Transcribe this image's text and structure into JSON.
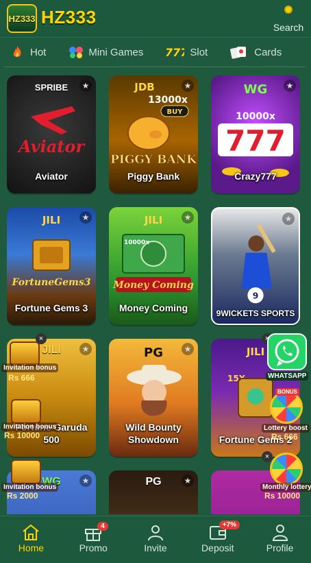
{
  "header": {
    "logo_badge": "HZ333",
    "brand": "HZ333",
    "search_label": "Search"
  },
  "categories": [
    {
      "label": "Hot",
      "icon": "flame-icon"
    },
    {
      "label": "Mini Games",
      "icon": "mini-games-icon"
    },
    {
      "label": "Slot",
      "icon": "slot-777-icon"
    },
    {
      "label": "Cards",
      "icon": "cards-icon"
    }
  ],
  "games": [
    {
      "title": "Aviator",
      "provider": "SPRIBE",
      "art_text": "Aviator"
    },
    {
      "title": "Piggy Bank",
      "provider": "JDB",
      "art_text": "PIGGY BANK",
      "multiplier": "13000x",
      "buy": "BUY"
    },
    {
      "title": "Crazy777",
      "provider": "WG",
      "art_text": "777",
      "multiplier": "10000x"
    },
    {
      "title": "Fortune Gems 3",
      "provider": "JILI",
      "art_text": "FortuneGems3"
    },
    {
      "title": "Money Coming",
      "provider": "JILI",
      "art_text": "Money Coming",
      "multiplier": "10000x"
    },
    {
      "title": "9WICKETS SPORTS",
      "provider": "",
      "art_text": "9"
    },
    {
      "title": "Fortune Garuda 500",
      "provider": "JILI",
      "art_text": ""
    },
    {
      "title": "Wild Bounty Showdown",
      "provider": "PG",
      "art_text": ""
    },
    {
      "title": "Fortune Gems 2",
      "provider": "JILI",
      "art_text": "15X"
    },
    {
      "title": "",
      "provider": "WG",
      "art_text": ""
    },
    {
      "title": "",
      "provider": "PG",
      "art_text": ""
    },
    {
      "title": "",
      "provider": "",
      "art_text": ""
    }
  ],
  "promos": {
    "invitation_1": {
      "label": "Invitation bonus",
      "amount": "Rs 666"
    },
    "invitation_2": {
      "label": "Invitation bonus",
      "amount": "Rs 10000"
    },
    "invitation_3": {
      "label": "Invitation bonus",
      "amount": "Rs 2000"
    },
    "whatsapp": {
      "label": "WHATSAPP"
    },
    "lottery_boost": {
      "label": "Lottery boost",
      "amount": "Rs 666",
      "bonus": "BONUS"
    },
    "monthly_lottery": {
      "label": "Monthly lottery",
      "amount": "Rs 10000"
    }
  },
  "bottom_nav": [
    {
      "label": "Home",
      "icon": "home-icon",
      "active": true
    },
    {
      "label": "Promo",
      "icon": "gift-icon",
      "badge": "4"
    },
    {
      "label": "Invite",
      "icon": "invite-icon"
    },
    {
      "label": "Deposit",
      "icon": "wallet-icon",
      "badge": "+7%"
    },
    {
      "label": "Profile",
      "icon": "profile-icon"
    }
  ],
  "colors": {
    "background": "#1f5a3e",
    "accent": "#ffd400",
    "badge": "#e53935"
  }
}
